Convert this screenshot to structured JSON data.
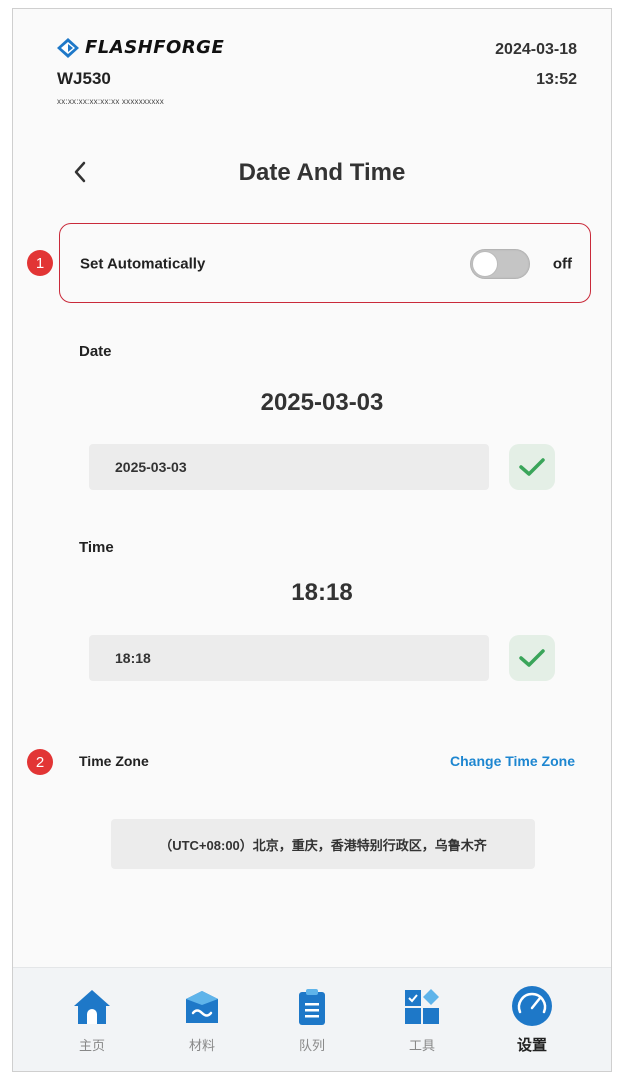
{
  "header": {
    "brand": "FLASHFORGE",
    "device_name": "WJ530",
    "device_sub": "xx:xx:xx:xx:xx:xx   xxxxxxxxxx",
    "date": "2024-03-18",
    "time": "13:52"
  },
  "page": {
    "title": "Date And Time",
    "back_icon": "chevron-left-icon"
  },
  "auto": {
    "label": "Set Automatically",
    "state": "off",
    "enabled": false,
    "marker": "1"
  },
  "date": {
    "label": "Date",
    "display": "2025-03-03",
    "input_value": "2025-03-03"
  },
  "time": {
    "label": "Time",
    "display": "18:18",
    "input_value": "18:18"
  },
  "timezone": {
    "marker": "2",
    "label": "Time Zone",
    "change_label": "Change Time Zone",
    "value": "（UTC+08:00）北京，重庆，香港特别行政区，乌鲁木齐"
  },
  "colors": {
    "accent_blue": "#1d86d0",
    "highlight_red": "#c92a3a",
    "marker_red": "#e23535",
    "check_green": "#3aa55a"
  },
  "nav": {
    "items": [
      {
        "label": "主页",
        "icon": "home-icon"
      },
      {
        "label": "材料",
        "icon": "material-icon"
      },
      {
        "label": "队列",
        "icon": "queue-icon"
      },
      {
        "label": "工具",
        "icon": "tools-icon"
      },
      {
        "label": "设置",
        "icon": "settings-icon",
        "active": true
      }
    ]
  }
}
